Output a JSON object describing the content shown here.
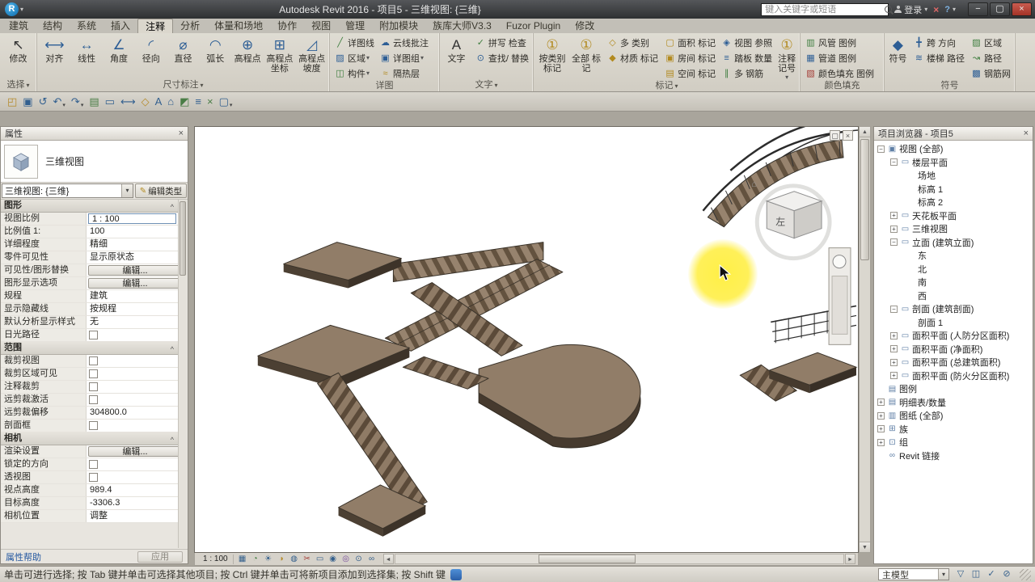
{
  "ui": {
    "caret": "▾"
  },
  "titlebar": {
    "logo": "R",
    "title": "Autodesk Revit 2016 - 项目5 - 三维视图: {三维}",
    "search_placeholder": "键入关键字或短语",
    "signin": "登录",
    "exchange_x": "×",
    "help": "?",
    "win_min": "−",
    "win_restore": "▢",
    "win_close": "×"
  },
  "ribbon": {
    "tabs": [
      {
        "label": "建筑"
      },
      {
        "label": "结构"
      },
      {
        "label": "系统"
      },
      {
        "label": "插入"
      },
      {
        "label": "注释",
        "cls": "active"
      },
      {
        "label": "分析"
      },
      {
        "label": "体量和场地"
      },
      {
        "label": "协作"
      },
      {
        "label": "视图"
      },
      {
        "label": "管理"
      },
      {
        "label": "附加模块"
      },
      {
        "label": "族库大师V3.3"
      },
      {
        "label": "Fuzor Plugin"
      },
      {
        "label": "修改"
      }
    ],
    "select_panel": {
      "label": "选择",
      "arrow": "▾",
      "button": {
        "label": "修改",
        "icon": "↖"
      }
    },
    "dim_panel": {
      "label": "尺寸标注",
      "arrow": "▾",
      "buttons": [
        {
          "label": "对齐",
          "icon": "⟷",
          "cls": "ic-b"
        },
        {
          "label": "线性",
          "icon": "↔",
          "cls": "ic-b"
        },
        {
          "label": "角度",
          "icon": "∠",
          "cls": "ic-b"
        },
        {
          "label": "径向",
          "icon": "◜",
          "cls": "ic-b"
        },
        {
          "label": "直径",
          "icon": "⌀",
          "cls": "ic-b"
        },
        {
          "label": "弧长",
          "icon": "◠",
          "cls": "ic-b"
        },
        {
          "label": "高程点",
          "icon": "⊕",
          "cls": "ic-b"
        },
        {
          "label": "高程点 坐标",
          "icon": "⊞",
          "cls": "ic-b"
        },
        {
          "label": "高程点 坡度",
          "icon": "◿",
          "cls": "ic-b"
        }
      ]
    },
    "detail_panel": {
      "label": "详图",
      "arrow": "",
      "buttons": [
        {
          "label": "详图线",
          "icon": "╱",
          "cls": "ic-g"
        },
        {
          "label": "区域",
          "icon": "▨",
          "cls": "ic-b",
          "caret": "▾"
        },
        {
          "label": "构件",
          "icon": "◫",
          "cls": "ic-g",
          "caret": "▾"
        },
        {
          "label": "云线批注",
          "icon": "☁",
          "cls": "ic-b"
        },
        {
          "label": "详图组",
          "icon": "▣",
          "cls": "ic-b",
          "caret": "▾"
        },
        {
          "label": "隔热层",
          "icon": "≈",
          "cls": "ic-y"
        }
      ]
    },
    "text_panel": {
      "label": "文字",
      "arrow": "▾",
      "big": {
        "label": "文字",
        "icon": "A"
      },
      "small": [
        {
          "label": "拼写 检查",
          "icon": "✓",
          "cls": "ic-g"
        },
        {
          "label": "查找/ 替换",
          "icon": "⊙",
          "cls": "ic-b"
        }
      ]
    },
    "tag_panel": {
      "label": "标记",
      "arrow": "▾",
      "big": [
        {
          "label": "按类别 标记",
          "icon": "①",
          "cls": "ic-y"
        },
        {
          "label": "全部 标记",
          "icon": "①",
          "cls": "ic-y"
        }
      ],
      "small_a": [
        {
          "label": "多 类别",
          "icon": "◇",
          "cls": "ic-y"
        },
        {
          "label": "材质 标记",
          "icon": "◆",
          "cls": "ic-y"
        }
      ],
      "small_b": [
        {
          "label": "面积 标记",
          "icon": "▢",
          "cls": "ic-y"
        },
        {
          "label": "房间 标记",
          "icon": "▣",
          "cls": "ic-y"
        },
        {
          "label": "空间 标记",
          "icon": "▤",
          "cls": "ic-y"
        },
        {
          "label": "视图 参照",
          "icon": "◈",
          "cls": "ic-b"
        },
        {
          "label": "踏板 数量",
          "icon": "≡",
          "cls": "ic-b"
        },
        {
          "label": "多 钢筋",
          "icon": "∥",
          "cls": "ic-g"
        }
      ],
      "keynote": {
        "label": "注释记号",
        "icon": "①",
        "caret": "▾"
      }
    },
    "color_panel": {
      "label": "颜色填充",
      "arrow": "",
      "buttons": [
        {
          "label": "风管 图例",
          "icon": "▥",
          "cls": "ic-g"
        },
        {
          "label": "管道 图例",
          "icon": "▦",
          "cls": "ic-b"
        },
        {
          "label": "颜色填充 图例",
          "icon": "▧",
          "cls": "ic-r"
        }
      ]
    },
    "symbol_panel": {
      "label": "符号",
      "arrow": "",
      "big": {
        "label": "符号",
        "icon": "◆"
      },
      "small_a": [
        {
          "label": "跨 方向",
          "icon": "╋",
          "cls": "ic-b"
        },
        {
          "label": "楼梯 路径",
          "icon": "≋",
          "cls": "ic-b"
        }
      ],
      "small_b": [
        {
          "label": "区域",
          "icon": "▨",
          "cls": "ic-g"
        },
        {
          "label": "路径",
          "icon": "↝",
          "cls": "ic-g"
        },
        {
          "label": "钢筋网",
          "icon": "▩",
          "cls": "ic-b"
        }
      ]
    }
  },
  "qat": {
    "icons": [
      {
        "g": "◰",
        "cls": "q-am"
      },
      {
        "g": "▣",
        "cls": "q-bl"
      },
      {
        "g": "↺",
        "cls": "q-bl"
      },
      {
        "g": "↶",
        "cls": "q-bl",
        "caret": "▾"
      },
      {
        "g": "↷",
        "cls": "q-bl",
        "caret": "▾"
      },
      {
        "g": "▤",
        "cls": "q-gr"
      },
      {
        "g": "▭",
        "cls": "q-bl"
      },
      {
        "g": "⟷",
        "cls": "q-bl"
      },
      {
        "g": "◇",
        "cls": "q-am"
      },
      {
        "g": "A",
        "cls": "q-bl"
      },
      {
        "g": "⌂",
        "cls": "q-bl"
      },
      {
        "g": "◩",
        "cls": "q-gr"
      },
      {
        "g": "≡",
        "cls": "q-bl"
      },
      {
        "g": "×",
        "cls": "q-gr"
      },
      {
        "g": "▢",
        "cls": "q-bl",
        "caret": "▾"
      }
    ]
  },
  "properties": {
    "title": "属性",
    "close": "×",
    "type_name": "三维视图",
    "instance": "三维视图: {三维}",
    "instance_caret": "▾",
    "edit_type": "编辑类型",
    "edit_type_icon": "✎",
    "rows": [
      {
        "t": "hdr",
        "label": "图形"
      },
      {
        "t": "val",
        "label": "视图比例",
        "value": "1 : 100",
        "cls": "boxed"
      },
      {
        "t": "val",
        "label": "比例值 1:",
        "value": "100"
      },
      {
        "t": "val",
        "label": "详细程度",
        "value": "精细"
      },
      {
        "t": "val",
        "label": "零件可见性",
        "value": "显示原状态"
      },
      {
        "t": "btn",
        "label": "可见性/图形替换",
        "value": "编辑..."
      },
      {
        "t": "btn",
        "label": "图形显示选项",
        "value": "编辑..."
      },
      {
        "t": "val",
        "label": "规程",
        "value": "建筑"
      },
      {
        "t": "val",
        "label": "显示隐藏线",
        "value": "按规程"
      },
      {
        "t": "val",
        "label": "默认分析显示样式",
        "value": "无"
      },
      {
        "t": "chk",
        "label": "日光路径"
      },
      {
        "t": "hdr",
        "label": "范围"
      },
      {
        "t": "chk",
        "label": "裁剪视图"
      },
      {
        "t": "chk",
        "label": "裁剪区域可见"
      },
      {
        "t": "chk",
        "label": "注释裁剪"
      },
      {
        "t": "chk",
        "label": "远剪裁激活"
      },
      {
        "t": "val",
        "label": "远剪裁偏移",
        "value": "304800.0"
      },
      {
        "t": "chk",
        "label": "剖面框"
      },
      {
        "t": "hdr",
        "label": "相机"
      },
      {
        "t": "btn",
        "label": "渲染设置",
        "value": "编辑..."
      },
      {
        "t": "chk",
        "label": "锁定的方向"
      },
      {
        "t": "chk",
        "label": "透视图"
      },
      {
        "t": "val",
        "label": "视点高度",
        "value": "989.4"
      },
      {
        "t": "val",
        "label": "目标高度",
        "value": "-3306.3"
      },
      {
        "t": "val",
        "label": "相机位置",
        "value": "调整"
      }
    ],
    "help": "属性帮助",
    "apply": "应用"
  },
  "canvas": {
    "restore": "▢",
    "close": "×",
    "viewcube": {
      "face": "左",
      "home": "⌂"
    },
    "scale": "1 : 100",
    "view_controls": [
      "▦",
      "◔",
      "☀",
      "◑",
      "◍",
      "✂",
      "▭",
      "◉",
      "◎",
      "⊙",
      "∞"
    ],
    "vscroll_up": "▲",
    "vscroll_down": "▼",
    "hscroll_left": "◄",
    "hscroll_right": "►"
  },
  "browser": {
    "title": "项目浏览器 - 项目5",
    "close": "×",
    "items": [
      {
        "ind": "i0",
        "expg": "−",
        "icon": "▣",
        "label": "视图 (全部)"
      },
      {
        "ind": "i1",
        "expg": "−",
        "icon": "▭",
        "label": "楼层平面"
      },
      {
        "ind": "i2",
        "expg": "",
        "icon": "",
        "label": "场地"
      },
      {
        "ind": "i2",
        "expg": "",
        "icon": "",
        "label": "标高 1"
      },
      {
        "ind": "i2",
        "expg": "",
        "icon": "",
        "label": "标高 2"
      },
      {
        "ind": "i1",
        "expg": "+",
        "icon": "▭",
        "label": "天花板平面"
      },
      {
        "ind": "i1",
        "expg": "+",
        "icon": "▭",
        "label": "三维视图"
      },
      {
        "ind": "i1",
        "expg": "−",
        "icon": "▭",
        "label": "立面 (建筑立面)"
      },
      {
        "ind": "i2",
        "expg": "",
        "icon": "",
        "label": "东"
      },
      {
        "ind": "i2",
        "expg": "",
        "icon": "",
        "label": "北"
      },
      {
        "ind": "i2",
        "expg": "",
        "icon": "",
        "label": "南"
      },
      {
        "ind": "i2",
        "expg": "",
        "icon": "",
        "label": "西"
      },
      {
        "ind": "i1",
        "expg": "−",
        "icon": "▭",
        "label": "剖面 (建筑剖面)"
      },
      {
        "ind": "i2",
        "expg": "",
        "icon": "",
        "label": "剖面 1"
      },
      {
        "ind": "i1",
        "expg": "+",
        "icon": "▭",
        "label": "面积平面 (人防分区面积)"
      },
      {
        "ind": "i1",
        "expg": "+",
        "icon": "▭",
        "label": "面积平面 (净面积)"
      },
      {
        "ind": "i1",
        "expg": "+",
        "icon": "▭",
        "label": "面积平面 (总建筑面积)"
      },
      {
        "ind": "i1",
        "expg": "+",
        "icon": "▭",
        "label": "面积平面 (防火分区面积)"
      },
      {
        "ind": "i0",
        "expg": "",
        "icon": "▤",
        "label": "图例"
      },
      {
        "ind": "i0",
        "expg": "+",
        "icon": "▤",
        "label": "明细表/数量"
      },
      {
        "ind": "i0",
        "expg": "+",
        "icon": "▥",
        "label": "图纸 (全部)"
      },
      {
        "ind": "i0",
        "expg": "+",
        "icon": "⊞",
        "label": "族"
      },
      {
        "ind": "i0",
        "expg": "+",
        "icon": "⊡",
        "label": "组"
      },
      {
        "ind": "i0",
        "expg": "",
        "icon": "∞",
        "label": "Revit 链接"
      }
    ]
  },
  "statusbar": {
    "hint": "单击可进行选择; 按 Tab 键并单击可选择其他项目; 按 Ctrl 键并单击可将新项目添加到选择集; 按 Shift 键",
    "model": "主模型",
    "icons": [
      "▽",
      "◫",
      "✓",
      "⊘"
    ]
  }
}
